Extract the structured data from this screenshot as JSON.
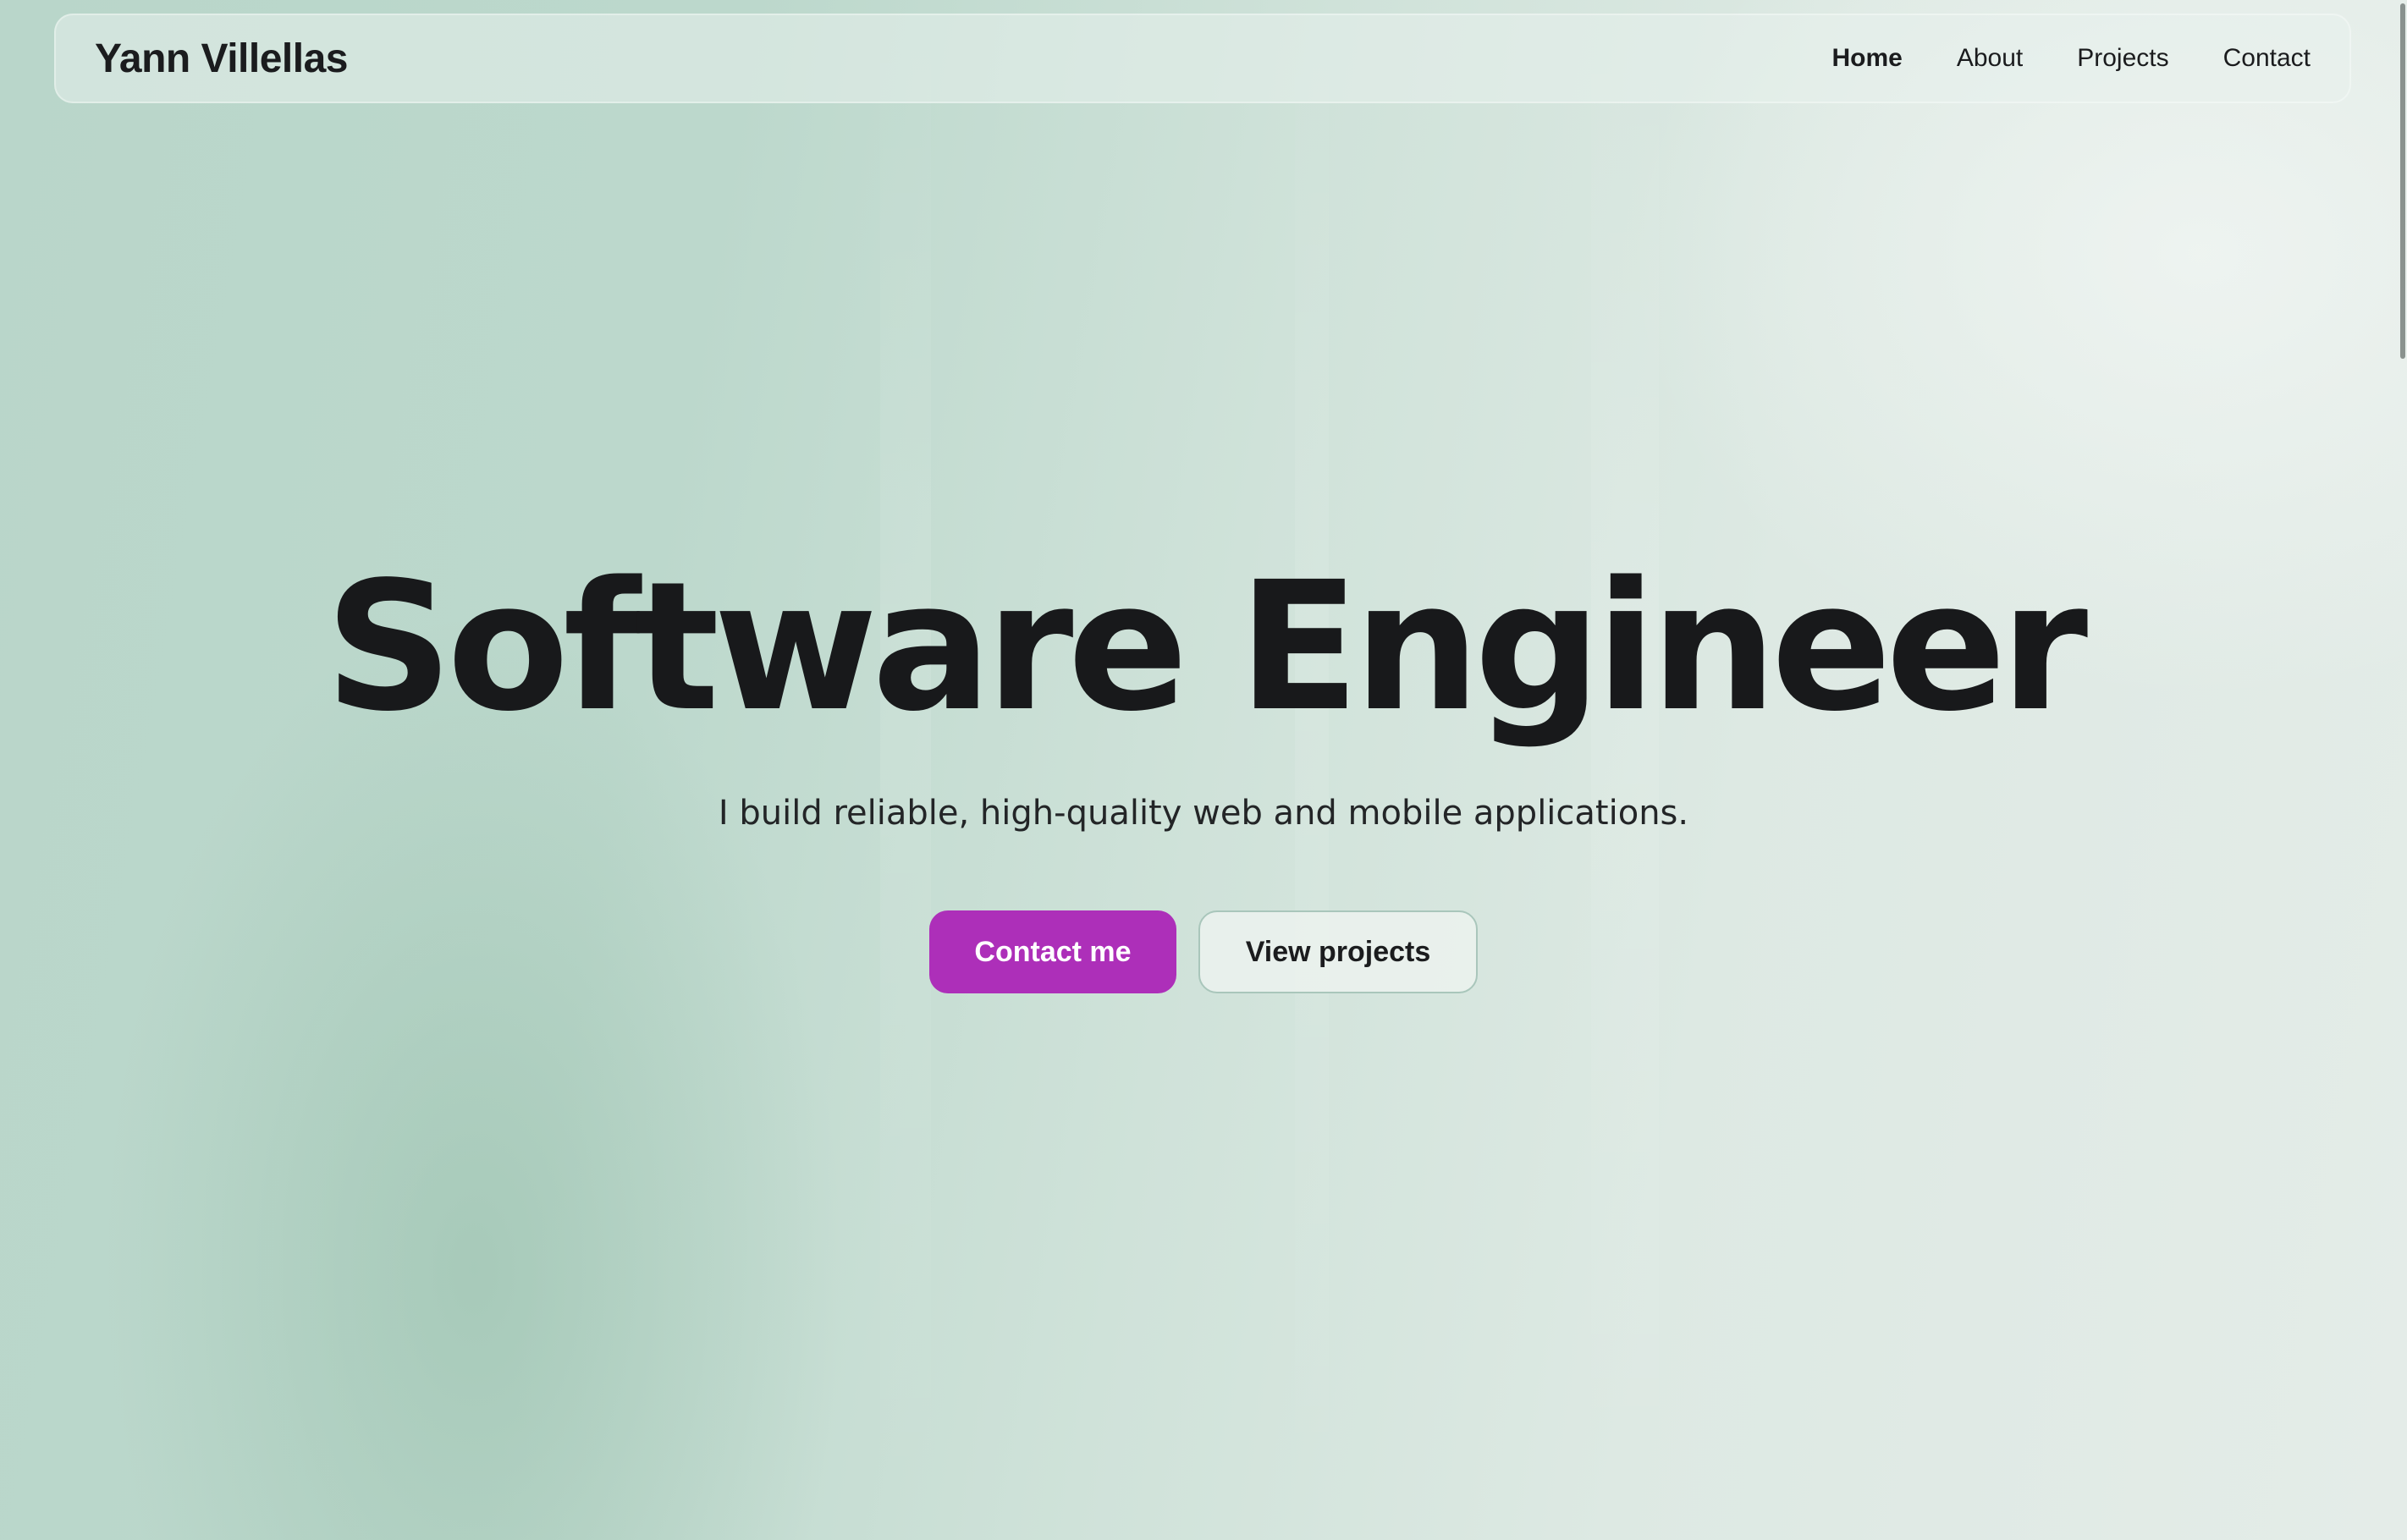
{
  "nav": {
    "brand": "Yann Villellas",
    "links": [
      {
        "label": "Home",
        "active": true
      },
      {
        "label": "About",
        "active": false
      },
      {
        "label": "Projects",
        "active": false
      },
      {
        "label": "Contact",
        "active": false
      }
    ]
  },
  "hero": {
    "title": "Software Engineer",
    "subtitle": "I build reliable, high-quality web and mobile applications.",
    "primary_button": "Contact me",
    "secondary_button": "View projects"
  },
  "colors": {
    "accent": "#ad2fb9",
    "text": "#18191b",
    "background": "#c7ded4"
  }
}
